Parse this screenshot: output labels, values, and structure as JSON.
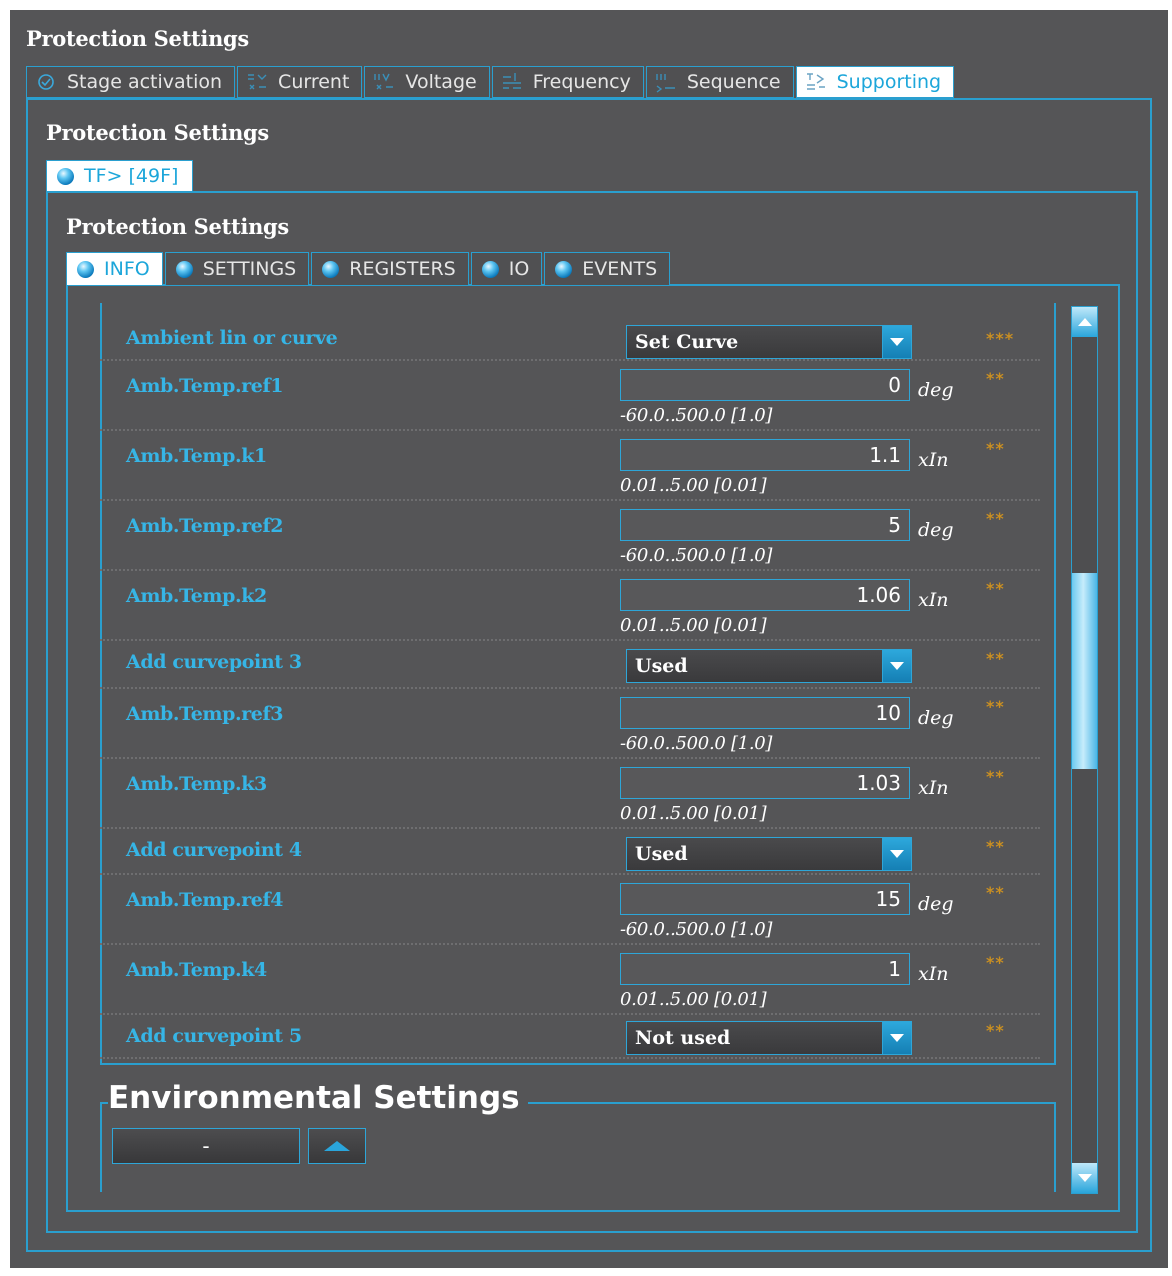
{
  "window": {
    "title": "Protection Settings"
  },
  "top_tabs": [
    {
      "label": "Stage activation",
      "icon": "check-circle-icon"
    },
    {
      "label": "Current",
      "icon": "current-icon"
    },
    {
      "label": "Voltage",
      "icon": "voltage-icon"
    },
    {
      "label": "Frequency",
      "icon": "frequency-icon"
    },
    {
      "label": "Sequence",
      "icon": "sequence-icon"
    },
    {
      "label": "Supporting",
      "icon": "supporting-icon",
      "active": true
    }
  ],
  "level2": {
    "title": "Protection Settings",
    "tab": "TF> [49F]"
  },
  "level3": {
    "title": "Protection Settings",
    "tabs": [
      "INFO",
      "SETTINGS",
      "REGISTERS",
      "IO",
      "EVENTS"
    ],
    "active_tab": "INFO"
  },
  "settings": [
    {
      "label": "Ambient lin or curve",
      "type": "select",
      "value": "Set Curve",
      "stars": "***"
    },
    {
      "label": "Amb.Temp.ref1",
      "type": "number",
      "value": "0",
      "unit": "deg",
      "range": "-60.0..500.0 [1.0]",
      "stars": "**"
    },
    {
      "label": "Amb.Temp.k1",
      "type": "number",
      "value": "1.1",
      "unit": "xIn",
      "range": "0.01..5.00 [0.01]",
      "stars": "**"
    },
    {
      "label": "Amb.Temp.ref2",
      "type": "number",
      "value": "5",
      "unit": "deg",
      "range": "-60.0..500.0 [1.0]",
      "stars": "**"
    },
    {
      "label": "Amb.Temp.k2",
      "type": "number",
      "value": "1.06",
      "unit": "xIn",
      "range": "0.01..5.00 [0.01]",
      "stars": "**"
    },
    {
      "label": "Add curvepoint 3",
      "type": "select",
      "value": "Used",
      "stars": "**"
    },
    {
      "label": "Amb.Temp.ref3",
      "type": "number",
      "value": "10",
      "unit": "deg",
      "range": "-60.0..500.0 [1.0]",
      "stars": "**"
    },
    {
      "label": "Amb.Temp.k3",
      "type": "number",
      "value": "1.03",
      "unit": "xIn",
      "range": "0.01..5.00 [0.01]",
      "stars": "**"
    },
    {
      "label": "Add curvepoint 4",
      "type": "select",
      "value": "Used",
      "stars": "**"
    },
    {
      "label": "Amb.Temp.ref4",
      "type": "number",
      "value": "15",
      "unit": "deg",
      "range": "-60.0..500.0 [1.0]",
      "stars": "**"
    },
    {
      "label": "Amb.Temp.k4",
      "type": "number",
      "value": "1",
      "unit": "xIn",
      "range": "0.01..5.00 [0.01]",
      "stars": "**"
    },
    {
      "label": "Add curvepoint 5",
      "type": "select",
      "value": "Not used",
      "stars": "**"
    }
  ],
  "environmental": {
    "title": "Environmental Settings",
    "button_label": "-"
  },
  "colors": {
    "accent": "#2a9fcf",
    "label": "#36b5e6",
    "stars": "#c98f22",
    "background": "#555557"
  }
}
